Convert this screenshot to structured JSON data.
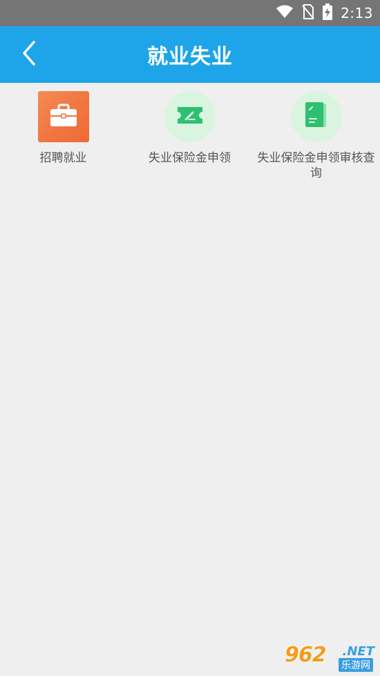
{
  "status_bar": {
    "time": "2:13",
    "icons": [
      "wifi-icon",
      "no-sim-icon",
      "battery-charging-icon"
    ]
  },
  "app_bar": {
    "back_icon": "chevron-left-icon",
    "title": "就业失业"
  },
  "features": [
    {
      "label": "招聘就业",
      "icon": "briefcase-icon",
      "color": "#f1743f"
    },
    {
      "label": "失业保险金申领",
      "icon": "ticket-icon",
      "color": "#2fbf71"
    },
    {
      "label": "失业保险金申领审核查询",
      "icon": "document-icon",
      "color": "#2fbf71"
    }
  ],
  "watermark": {
    "brand": "962",
    "suffix": ".NET",
    "subtitle": "乐游网"
  }
}
